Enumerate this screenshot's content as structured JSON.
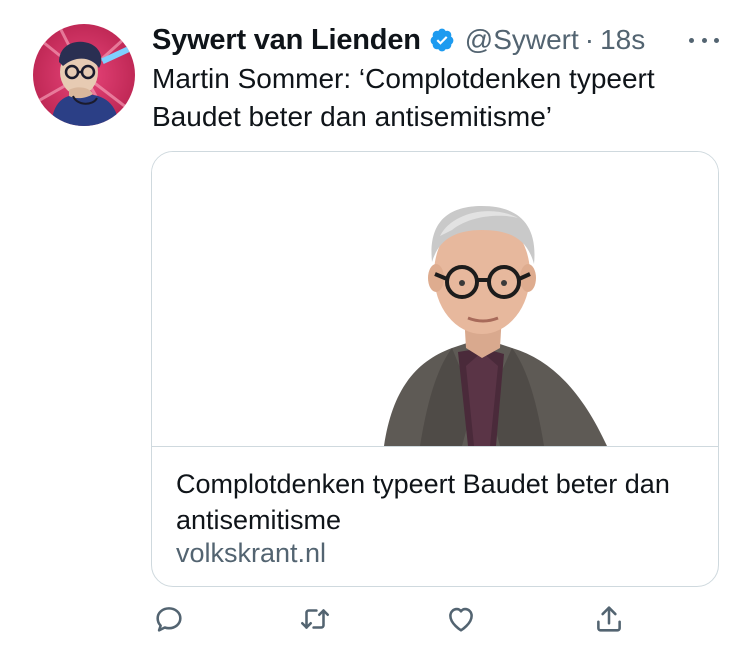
{
  "tweet": {
    "author": {
      "display_name": "Sywert van Lienden",
      "handle": "@Sywert",
      "verified_icon": "verified-badge-icon"
    },
    "separator": "·",
    "time": "18s",
    "text": "Martin Sommer: ‘Complotdenken typeert Baudet beter dan antisemitisme’",
    "more_icon": "ellipsis-icon"
  },
  "card": {
    "title": "Complotdenken typeert Baudet beter dan antisemitisme",
    "domain": "volkskrant.nl"
  },
  "actions": [
    {
      "icon": "reply-icon"
    },
    {
      "icon": "retweet-icon"
    },
    {
      "icon": "like-icon"
    },
    {
      "icon": "share-icon"
    }
  ],
  "colors": {
    "accent": "#1d9bf0",
    "text_primary": "#0f1419",
    "text_secondary": "#536471",
    "border": "#cfd9de"
  }
}
